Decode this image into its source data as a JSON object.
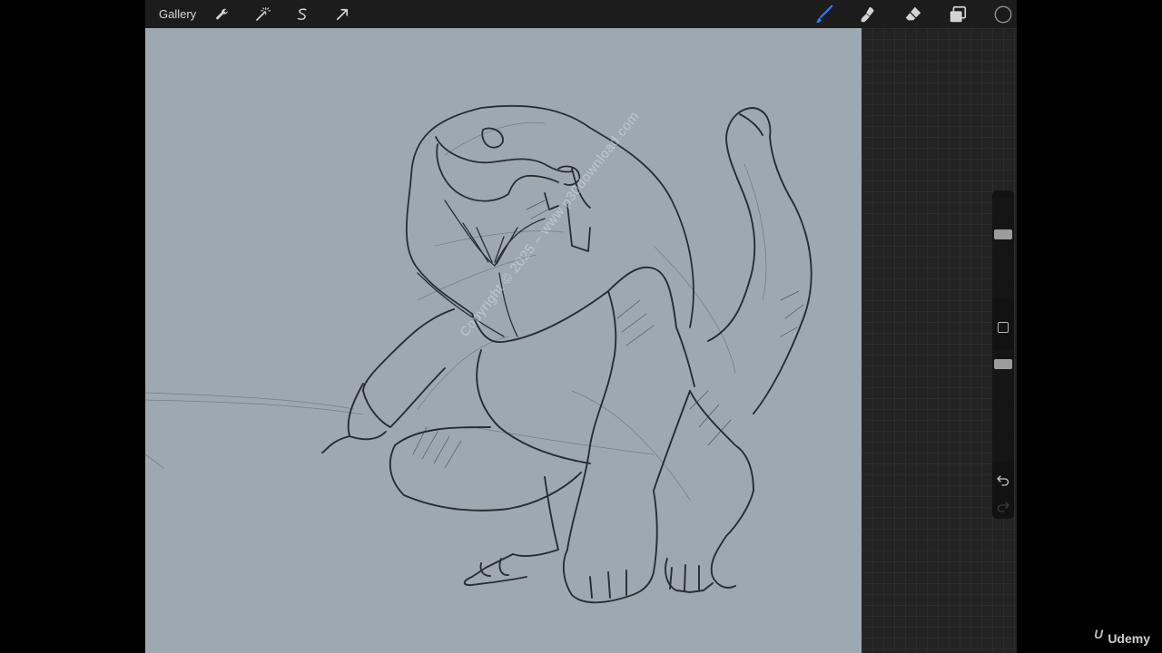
{
  "topbar": {
    "gallery_label": "Gallery",
    "left_tools": [
      "wrench-icon",
      "magic-wand-icon",
      "selection-icon",
      "transform-arrow-icon"
    ],
    "right_tools": [
      "brush-icon",
      "smudge-icon",
      "eraser-icon",
      "layers-icon",
      "color-picker-icon"
    ],
    "active_tool": "brush",
    "active_color": "#2d7cf6",
    "current_color": "#1a1a1a"
  },
  "canvas": {
    "background": "#9ea8b1",
    "watermark": "Copyright © 2025 – www.p30download.com"
  },
  "sidebar": {
    "brush_size_level": 0.35,
    "opacity_level": 0.1,
    "icons": [
      "modify-square-icon",
      "undo-icon",
      "redo-icon"
    ]
  },
  "brand": {
    "logo_text": "Udemy"
  }
}
